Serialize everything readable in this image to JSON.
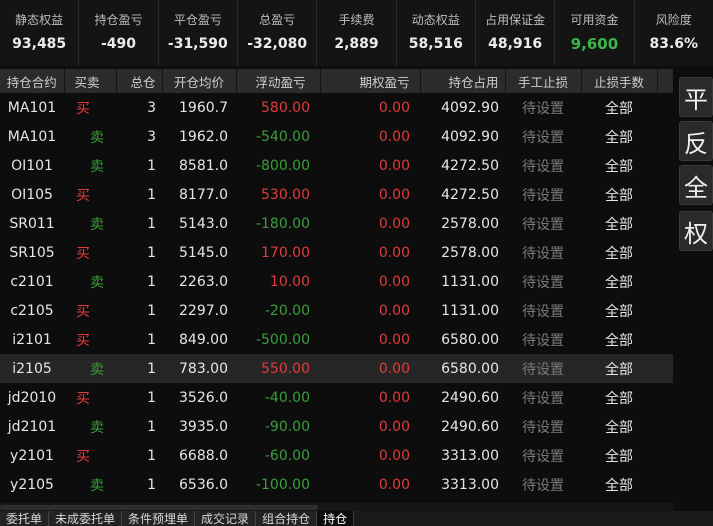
{
  "summary": [
    {
      "label": "静态权益",
      "value": "93,485",
      "color": "normal"
    },
    {
      "label": "持仓盈亏",
      "value": "-490",
      "color": "normal"
    },
    {
      "label": "平仓盈亏",
      "value": "-31,590",
      "color": "normal"
    },
    {
      "label": "总盈亏",
      "value": "-32,080",
      "color": "normal"
    },
    {
      "label": "手续费",
      "value": "2,889",
      "color": "normal"
    },
    {
      "label": "动态权益",
      "value": "58,516",
      "color": "normal"
    },
    {
      "label": "占用保证金",
      "value": "48,916",
      "color": "normal"
    },
    {
      "label": "可用资金",
      "value": "9,600",
      "color": "green"
    },
    {
      "label": "风险度",
      "value": "83.6%",
      "color": "normal"
    }
  ],
  "table": {
    "headers": [
      "持仓合约",
      "买卖",
      "总仓",
      "开仓均价",
      "浮动盈亏",
      "期权盈亏",
      "持仓占用",
      "手工止损",
      "止损手数"
    ],
    "rows": [
      {
        "contract": "MA101",
        "side": "买",
        "qty": "3",
        "avg_price": "1960.7",
        "float_pnl": "580.00",
        "option_pnl": "0.00",
        "margin": "4092.90",
        "manual_stop": "待设置",
        "stop_lots": "全部"
      },
      {
        "contract": "MA101",
        "side": "卖",
        "qty": "3",
        "avg_price": "1962.0",
        "float_pnl": "-540.00",
        "option_pnl": "0.00",
        "margin": "4092.90",
        "manual_stop": "待设置",
        "stop_lots": "全部"
      },
      {
        "contract": "OI101",
        "side": "卖",
        "qty": "1",
        "avg_price": "8581.0",
        "float_pnl": "-800.00",
        "option_pnl": "0.00",
        "margin": "4272.50",
        "manual_stop": "待设置",
        "stop_lots": "全部"
      },
      {
        "contract": "OI105",
        "side": "买",
        "qty": "1",
        "avg_price": "8177.0",
        "float_pnl": "530.00",
        "option_pnl": "0.00",
        "margin": "4272.50",
        "manual_stop": "待设置",
        "stop_lots": "全部"
      },
      {
        "contract": "SR011",
        "side": "卖",
        "qty": "1",
        "avg_price": "5143.0",
        "float_pnl": "-180.00",
        "option_pnl": "0.00",
        "margin": "2578.00",
        "manual_stop": "待设置",
        "stop_lots": "全部"
      },
      {
        "contract": "SR105",
        "side": "买",
        "qty": "1",
        "avg_price": "5145.0",
        "float_pnl": "170.00",
        "option_pnl": "0.00",
        "margin": "2578.00",
        "manual_stop": "待设置",
        "stop_lots": "全部"
      },
      {
        "contract": "c2101",
        "side": "卖",
        "qty": "1",
        "avg_price": "2263.0",
        "float_pnl": "10.00",
        "option_pnl": "0.00",
        "margin": "1131.00",
        "manual_stop": "待设置",
        "stop_lots": "全部"
      },
      {
        "contract": "c2105",
        "side": "买",
        "qty": "1",
        "avg_price": "2297.0",
        "float_pnl": "-20.00",
        "option_pnl": "0.00",
        "margin": "1131.00",
        "manual_stop": "待设置",
        "stop_lots": "全部"
      },
      {
        "contract": "i2101",
        "side": "买",
        "qty": "1",
        "avg_price": "849.00",
        "float_pnl": "-500.00",
        "option_pnl": "0.00",
        "margin": "6580.00",
        "manual_stop": "待设置",
        "stop_lots": "全部"
      },
      {
        "contract": "i2105",
        "side": "卖",
        "qty": "1",
        "avg_price": "783.00",
        "float_pnl": "550.00",
        "option_pnl": "0.00",
        "margin": "6580.00",
        "manual_stop": "待设置",
        "stop_lots": "全部",
        "selected": true
      },
      {
        "contract": "jd2010",
        "side": "买",
        "qty": "1",
        "avg_price": "3526.0",
        "float_pnl": "-40.00",
        "option_pnl": "0.00",
        "margin": "2490.60",
        "manual_stop": "待设置",
        "stop_lots": "全部"
      },
      {
        "contract": "jd2101",
        "side": "卖",
        "qty": "1",
        "avg_price": "3935.0",
        "float_pnl": "-90.00",
        "option_pnl": "0.00",
        "margin": "2490.60",
        "manual_stop": "待设置",
        "stop_lots": "全部"
      },
      {
        "contract": "y2101",
        "side": "买",
        "qty": "1",
        "avg_price": "6688.0",
        "float_pnl": "-60.00",
        "option_pnl": "0.00",
        "margin": "3313.00",
        "manual_stop": "待设置",
        "stop_lots": "全部"
      },
      {
        "contract": "y2105",
        "side": "卖",
        "qty": "1",
        "avg_price": "6536.0",
        "float_pnl": "-100.00",
        "option_pnl": "0.00",
        "margin": "3313.00",
        "manual_stop": "待设置",
        "stop_lots": "全部"
      }
    ]
  },
  "side_actions": [
    "平",
    "反",
    "全",
    "权"
  ],
  "tabs": [
    {
      "label": "委托单",
      "active": false
    },
    {
      "label": "未成委托单",
      "active": false
    },
    {
      "label": "条件预埋单",
      "active": false
    },
    {
      "label": "成交记录",
      "active": false
    },
    {
      "label": "组合持仓",
      "active": false
    },
    {
      "label": "持仓",
      "active": true
    }
  ],
  "colors": {
    "buy": "#e23b3b",
    "sell": "#3a9e3a",
    "available_funds": "#3bb54a",
    "background": "#0d0d0d",
    "header_bg": "#2b2b2b",
    "selected_row": "#262626"
  }
}
